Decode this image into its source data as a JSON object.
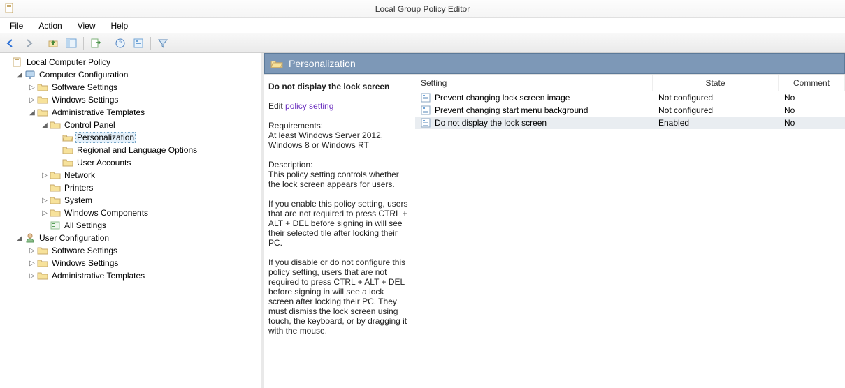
{
  "window": {
    "title": "Local Group Policy Editor"
  },
  "menu": {
    "file": "File",
    "action": "Action",
    "view": "View",
    "help": "Help"
  },
  "tree": {
    "root": "Local Computer Policy",
    "computer_config": "Computer Configuration",
    "cc_software": "Software Settings",
    "cc_windows": "Windows Settings",
    "cc_admin": "Administrative Templates",
    "control_panel": "Control Panel",
    "personalization": "Personalization",
    "regional": "Regional and Language Options",
    "user_accounts": "User Accounts",
    "network": "Network",
    "printers": "Printers",
    "system": "System",
    "win_components": "Windows Components",
    "all_settings": "All Settings",
    "user_config": "User Configuration",
    "uc_software": "Software Settings",
    "uc_windows": "Windows Settings",
    "uc_admin": "Administrative Templates"
  },
  "content": {
    "header": "Personalization",
    "selected_setting": "Do not display the lock screen",
    "edit_prefix": "Edit ",
    "edit_link": "policy setting ",
    "req_head": "Requirements:",
    "req_body": "At least Windows Server 2012, Windows 8 or Windows RT",
    "desc_head": "Description:",
    "desc_p1": "This policy setting controls whether the lock screen appears for users.",
    "desc_p2": "If you enable this policy setting, users that are not required to press CTRL + ALT + DEL before signing in will see their selected tile after  locking their PC.",
    "desc_p3": "If you disable or do not configure this policy setting, users that are not required to press CTRL + ALT + DEL before signing in will see a lock screen after locking their PC. They must dismiss the lock screen using touch, the keyboard, or by dragging it with the mouse."
  },
  "columns": {
    "setting": "Setting",
    "state": "State",
    "comment": "Comment"
  },
  "settings": [
    {
      "name": "Prevent changing lock screen image",
      "state": "Not configured",
      "comment": "No"
    },
    {
      "name": "Prevent changing start menu background",
      "state": "Not configured",
      "comment": "No"
    },
    {
      "name": "Do not display the lock screen",
      "state": "Enabled",
      "comment": "No"
    }
  ]
}
